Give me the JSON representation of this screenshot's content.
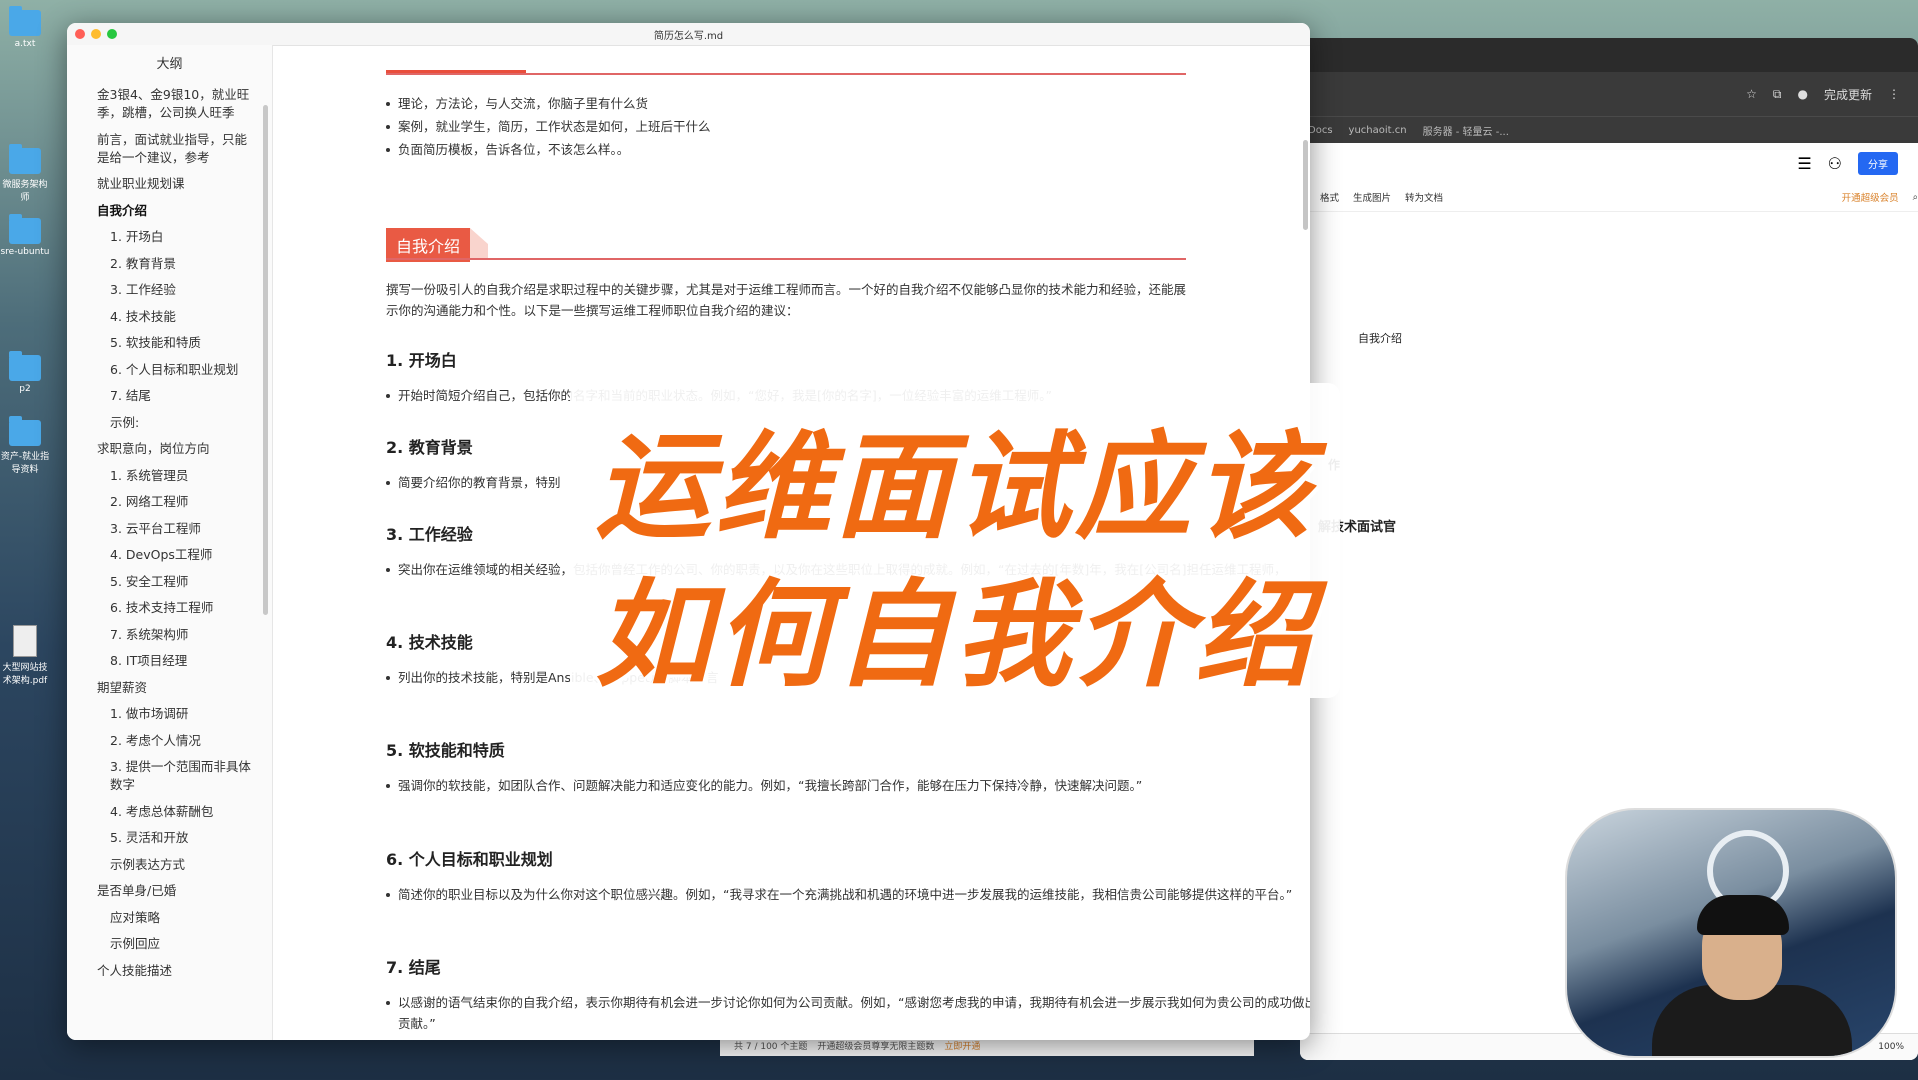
{
  "desktop": {
    "icons": [
      {
        "label": "a.txt"
      },
      {
        "label": "微服务架构师"
      },
      {
        "label": "sre-ubuntu"
      },
      {
        "label": "p2"
      },
      {
        "label": "资产-就业指导资料"
      },
      {
        "label": "大型网站技术架构.pdf"
      }
    ]
  },
  "browser": {
    "update_label": "完成更新",
    "bookmarks": [
      "Docs",
      "yuchaoit.cn",
      "服务器 - 轻量云 -..."
    ],
    "share_label": "分享",
    "format_bar": [
      "格式",
      "生成图片",
      "转为文档"
    ],
    "vip_label": "开通超级会员",
    "mindmap": {
      "node1": "自我介绍",
      "node2": "作",
      "node3": "解技术面试官"
    },
    "zoom": "100%",
    "status": {
      "topics": "共 7 / 100 个主题",
      "promo": "开通超级会员尊享无限主题数",
      "action": "立即开通"
    }
  },
  "editor": {
    "file_title": "简历怎么写.md",
    "outline_title": "大纲",
    "outline": [
      {
        "text": "金3银4、金9银10，就业旺季，跳槽，公司换人旺季",
        "level": 1
      },
      {
        "text": "前言，面试就业指导，只能是给一个建议，参考",
        "level": 1
      },
      {
        "text": "就业职业规划课",
        "level": 1
      },
      {
        "text": "自我介绍",
        "level": 1,
        "active": true
      },
      {
        "text": "1. 开场白",
        "level": 2
      },
      {
        "text": "2. 教育背景",
        "level": 2
      },
      {
        "text": "3. 工作经验",
        "level": 2
      },
      {
        "text": "4. 技术技能",
        "level": 2
      },
      {
        "text": "5. 软技能和特质",
        "level": 2
      },
      {
        "text": "6. 个人目标和职业规划",
        "level": 2
      },
      {
        "text": "7. 结尾",
        "level": 2
      },
      {
        "text": "示例:",
        "level": 2
      },
      {
        "text": "求职意向，岗位方向",
        "level": 1
      },
      {
        "text": "1. 系统管理员",
        "level": 2
      },
      {
        "text": "2. 网络工程师",
        "level": 2
      },
      {
        "text": "3. 云平台工程师",
        "level": 2
      },
      {
        "text": "4. DevOps工程师",
        "level": 2
      },
      {
        "text": "5. 安全工程师",
        "level": 2
      },
      {
        "text": "6. 技术支持工程师",
        "level": 2
      },
      {
        "text": "7. 系统架构师",
        "level": 2
      },
      {
        "text": "8. IT项目经理",
        "level": 2
      },
      {
        "text": "期望薪资",
        "level": 1
      },
      {
        "text": "1. 做市场调研",
        "level": 2
      },
      {
        "text": "2. 考虑个人情况",
        "level": 2
      },
      {
        "text": "3. 提供一个范围而非具体数字",
        "level": 2
      },
      {
        "text": "4. 考虑总体薪酬包",
        "level": 2
      },
      {
        "text": "5. 灵活和开放",
        "level": 2
      },
      {
        "text": "示例表达方式",
        "level": 2
      },
      {
        "text": "是否单身/已婚",
        "level": 1
      },
      {
        "text": "应对策略",
        "level": 2
      },
      {
        "text": "示例回应",
        "level": 2
      },
      {
        "text": "个人技能描述",
        "level": 1
      }
    ],
    "top_bullets": [
      "理论，方法论，与人交流，你脑子里有什么货",
      "案例，就业学生，简历，工作状态是如何，上班后干什么",
      "负面简历模板，告诉各位，不该怎么样。。"
    ],
    "section_tag": "自我介绍",
    "intro": "撰写一份吸引人的自我介绍是求职过程中的关键步骤，尤其是对于运维工程师而言。一个好的自我介绍不仅能够凸显你的技术能力和经验，还能展示你的沟通能力和个性。以下是一些撰写运维工程师职位自我介绍的建议：",
    "sections": [
      {
        "title": "1. 开场白",
        "body": "开始时简短介绍自己，包括你的名字和当前的职业状态。例如，“您好，我是[你的名字]，一位经验丰富的运维工程师。”"
      },
      {
        "title": "2. 教育背景",
        "body": "简要介绍你的教育背景，特别"
      },
      {
        "title": "3. 工作经验",
        "body": "突出你在运维领域的相关经验，包括你曾经工作的公司、你的职责，以及你在这些职位上取得的成就。例如，“在过去的[年数]年，我在[公司名]担任运维工程师，"
      },
      {
        "title": "4. 技术技能",
        "body": "列出你的技术技能，特别是Ansible、Puppet）、脚本语言"
      },
      {
        "title": "5. 软技能和特质",
        "body": "强调你的软技能，如团队合作、问题解决能力和适应变化的能力。例如，“我擅长跨部门合作，能够在压力下保持冷静，快速解决问题。”"
      },
      {
        "title": "6. 个人目标和职业规划",
        "body": "简述你的职业目标以及为什么你对这个职位感兴趣。例如，“我寻求在一个充满挑战和机遇的环境中进一步发展我的运维技能，我相信贵公司能够提供这样的平台。”"
      },
      {
        "title": "7. 结尾",
        "body": "以感谢的语气结束你的自我介绍，表示你期待有机会进一步讨论你如何为公司贡献。例如，“感谢您考虑我的申请，我期待有机会进一步展示我如何为贵公司的成功做出贡献。”"
      }
    ]
  },
  "overlay": {
    "line1": "运维面试应该",
    "line2": "如何自我介绍"
  },
  "colors": {
    "accent": "#e95a44",
    "overlay_text": "#f06a12"
  }
}
